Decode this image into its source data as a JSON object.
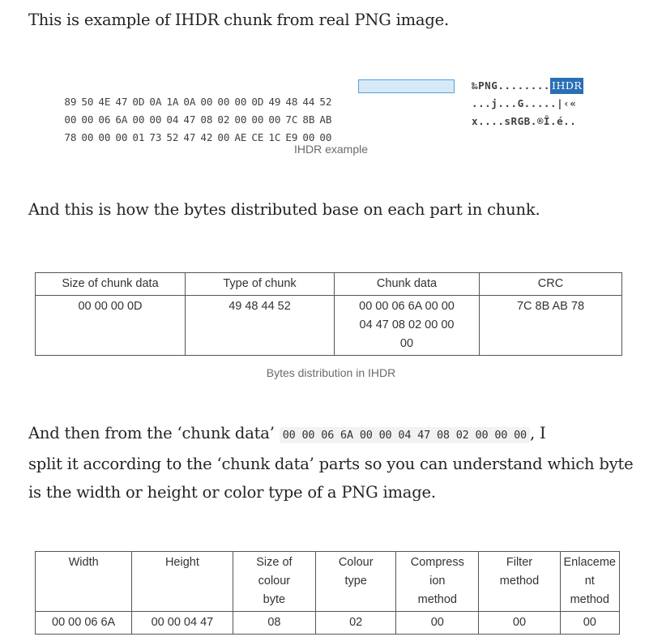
{
  "intro": "This is example of IHDR chunk from real PNG image.",
  "hexdump": {
    "rows": [
      {
        "bytes": [
          "89",
          "50",
          "4E",
          "47",
          "0D",
          "0A",
          "1A",
          "0A",
          "00",
          "00",
          "00",
          "0D",
          "49",
          "48",
          "44",
          "52"
        ],
        "ascii_pre": "‰PNG........",
        "ascii_hl": "IHDR"
      },
      {
        "bytes": [
          "00",
          "00",
          "06",
          "6A",
          "00",
          "00",
          "04",
          "47",
          "08",
          "02",
          "00",
          "00",
          "00",
          "7C",
          "8B",
          "AB"
        ],
        "ascii_pre": "...j...G.....|‹«",
        "ascii_hl": ""
      },
      {
        "bytes": [
          "78",
          "00",
          "00",
          "00",
          "01",
          "73",
          "52",
          "47",
          "42",
          "00",
          "AE",
          "CE",
          "1C",
          "E9",
          "00",
          "00"
        ],
        "ascii_pre": "x....sRGB.®Î.é..",
        "ascii_hl": ""
      }
    ]
  },
  "caption1": "IHDR example",
  "para2": "And this is how the bytes distributed base on each part in chunk.",
  "table1": {
    "headers": [
      "Size of chunk data",
      "Type of chunk",
      "Chunk data",
      "CRC"
    ],
    "size": "00 00 00 0D",
    "type": "49 48 44 52",
    "chunk_data": [
      "00 00 06 6A 00 00",
      "04 47 08 02 00 00",
      "00"
    ],
    "crc": "7C 8B AB 78"
  },
  "caption2": "Bytes distribution in IHDR",
  "para3": {
    "before": "And then from the ‘chunk data’ ",
    "code": "00 00 06 6A 00 00 04 47 08 02 00 00 00",
    "after_line1": ", I",
    "line2": "split it according to the ‘chunk data’ parts so you can understand which byte",
    "line3": "is the width or height or color type of a PNG image."
  },
  "table2": {
    "headers": [
      [
        "Width"
      ],
      [
        "Height"
      ],
      [
        "Size of",
        "colour",
        "byte"
      ],
      [
        "Colour",
        "type"
      ],
      [
        "Compress",
        "ion",
        "method"
      ],
      [
        "Filter",
        "method"
      ],
      [
        "Enlaceme",
        "nt",
        "method"
      ]
    ],
    "values": [
      "00 00 06 6A",
      "00 00 04 47",
      "08",
      "02",
      "00",
      "00",
      "00"
    ]
  }
}
